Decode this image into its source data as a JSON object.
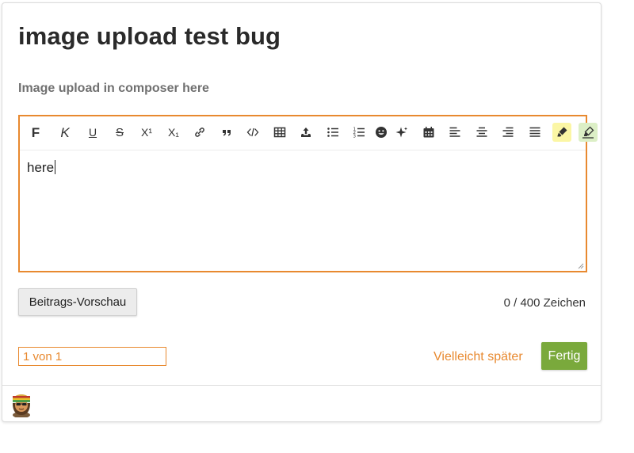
{
  "post": {
    "title": "image upload test bug",
    "subtitle": "Image upload in composer here"
  },
  "editor": {
    "content": "here",
    "toolbar": [
      {
        "name": "bold-button",
        "icon": "bold-icon",
        "label": "F"
      },
      {
        "name": "italic-button",
        "icon": "italic-icon",
        "label": "K"
      },
      {
        "name": "underline-button",
        "icon": "underline-icon",
        "label": "U"
      },
      {
        "name": "strikethrough-button",
        "icon": "strikethrough-icon",
        "label": "S"
      },
      {
        "name": "superscript-button",
        "icon": "superscript-icon",
        "label": "X¹"
      },
      {
        "name": "subscript-button",
        "icon": "subscript-icon",
        "label": "X₁"
      },
      {
        "name": "link-button",
        "icon": "link-icon"
      },
      {
        "name": "quote-button",
        "icon": "quote-icon"
      },
      {
        "name": "code-button",
        "icon": "code-icon"
      },
      {
        "name": "table-button",
        "icon": "table-icon"
      },
      {
        "name": "upload-button",
        "icon": "upload-icon"
      },
      {
        "name": "bullet-list-button",
        "icon": "bullet-list-icon"
      },
      {
        "name": "numbered-list-button",
        "icon": "numbered-list-icon"
      },
      {
        "name": "emoji-button",
        "icon": "emoji-icon"
      },
      {
        "name": "sparkle-button",
        "icon": "sparkle-icon"
      },
      {
        "name": "calendar-button",
        "icon": "calendar-icon"
      },
      {
        "name": "align-left-button",
        "icon": "align-left-icon"
      },
      {
        "name": "align-center-button",
        "icon": "align-center-icon"
      },
      {
        "name": "align-right-button",
        "icon": "align-right-icon"
      },
      {
        "name": "align-justify-button",
        "icon": "align-justify-icon"
      },
      {
        "name": "highlight-yellow-button",
        "icon": "highlighter-icon",
        "color": "#fbf6a5"
      },
      {
        "name": "highlight-green-button",
        "icon": "highlighter-icon",
        "color": "#dcefc6"
      },
      {
        "name": "highlight-red-button",
        "icon": "highlighter-icon",
        "color": "#f7d9da"
      }
    ]
  },
  "actions": {
    "preview_label": "Beitrags-Vorschau",
    "char_counter": "0 / 400 Zeichen",
    "pager_text": "1 von 1",
    "later_label": "Vielleicht später",
    "done_label": "Fertig"
  },
  "colors": {
    "accent": "#e8892f",
    "success": "#7aa93c"
  },
  "user": {
    "avatar_icon": "avatar-emoji-icon"
  }
}
